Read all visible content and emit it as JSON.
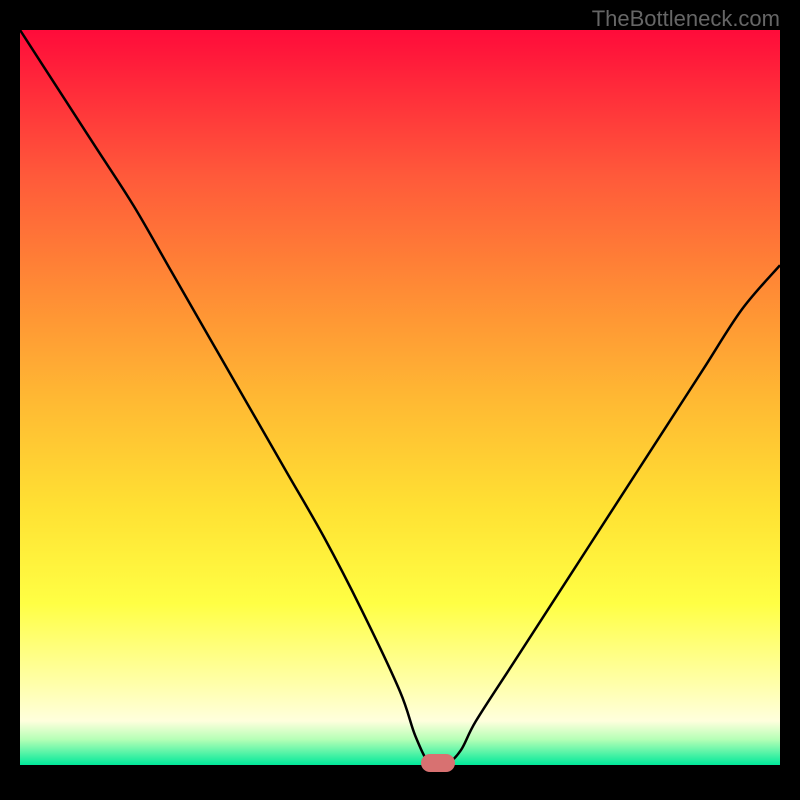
{
  "watermark": "TheBottleneck.com",
  "chart_data": {
    "type": "line",
    "title": "",
    "xlabel": "",
    "ylabel": "",
    "x": [
      0,
      5,
      10,
      15,
      20,
      25,
      30,
      35,
      40,
      45,
      50,
      52,
      54,
      56,
      58,
      60,
      65,
      70,
      75,
      80,
      85,
      90,
      95,
      100
    ],
    "y": [
      100,
      92,
      84,
      76,
      67,
      58,
      49,
      40,
      31,
      21,
      10,
      4,
      0,
      0,
      2,
      6,
      14,
      22,
      30,
      38,
      46,
      54,
      62,
      68
    ],
    "ylim": [
      0,
      100
    ],
    "xlim": [
      0,
      100
    ],
    "marker": {
      "x": 55,
      "y": 0
    },
    "background_gradient": {
      "top": "#ff0b3a",
      "mid_upper": "#ffb833",
      "mid_lower": "#ffff44",
      "bottom": "#00e99a"
    }
  }
}
